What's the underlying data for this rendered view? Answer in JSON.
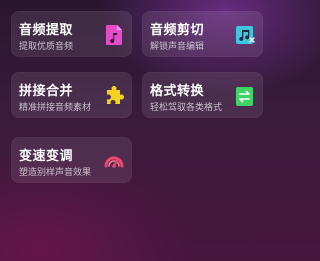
{
  "tools": [
    {
      "title": "音频提取",
      "subtitle": "提取优质音频",
      "icon": "music-file-icon",
      "color": "#e54cc8"
    },
    {
      "title": "音频剪切",
      "subtitle": "解锁声音编辑",
      "icon": "music-scissors-icon",
      "color": "#3ec6e0"
    },
    {
      "title": "拼接合并",
      "subtitle": "精准拼接音频素材",
      "icon": "puzzle-icon",
      "color": "#f2d21a"
    },
    {
      "title": "格式转换",
      "subtitle": "轻松驾驭各类格式",
      "icon": "convert-arrows-icon",
      "color": "#3fd36a"
    },
    {
      "title": "变速变调",
      "subtitle": "塑造别样声音效果",
      "icon": "speedometer-icon",
      "color": "#f0466e"
    }
  ]
}
